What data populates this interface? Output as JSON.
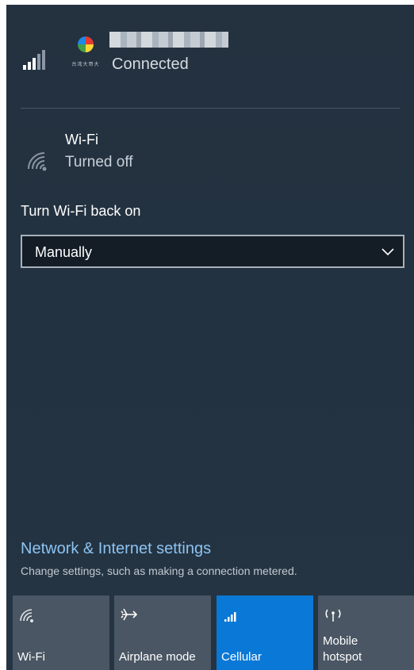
{
  "network": {
    "status": "Connected",
    "carrier_logo_text": "台湾大哥大"
  },
  "wifi": {
    "title": "Wi-Fi",
    "status": "Turned off"
  },
  "turn_on": {
    "label": "Turn Wi-Fi back on",
    "selected": "Manually"
  },
  "settings": {
    "link": "Network & Internet settings",
    "description": "Change settings, such as making a connection metered."
  },
  "tiles": [
    {
      "label": "Wi-Fi",
      "icon": "wifi-icon",
      "active": false
    },
    {
      "label": "Airplane mode",
      "icon": "airplane-icon",
      "active": false
    },
    {
      "label": "Cellular",
      "icon": "cellular-icon",
      "active": true
    },
    {
      "label": "Mobile\nhotspot",
      "icon": "hotspot-icon",
      "active": false
    }
  ],
  "colors": {
    "background": "#24313f",
    "accent": "#0a78d6",
    "link": "#8cc3f2",
    "tile": "#4a5663"
  }
}
